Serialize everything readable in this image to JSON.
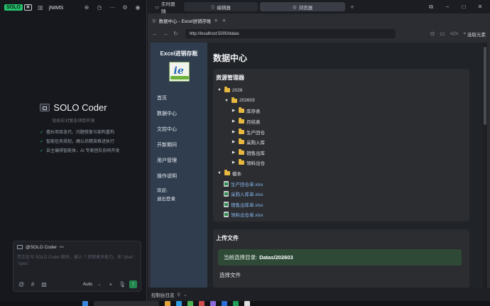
{
  "left": {
    "badge": "SOLO",
    "project_name": "jNIMS",
    "hero_title": "SOLO Coder",
    "hero_subtitle": "轻松应对复杂项目开发",
    "features": [
      "擅长项目迭代、问题修复与架构重构",
      "智能任务规划，确认后精准推进执行",
      "自主编排智能体，AI 专家团队协同开发"
    ],
    "composer": {
      "agent": "@SOLO Coder",
      "placeholder": "您正在与 SOLO Coder 聊天，输入 '/' 获取更多能力，如 '/plan', '/spec'",
      "mode": "Auto"
    }
  },
  "titlebar": {
    "tabs": [
      {
        "label": "实时跟随",
        "icon": "monitor-icon"
      },
      {
        "label": "编辑器",
        "icon": "code-icon"
      },
      {
        "label": "浏览器",
        "icon": "globe-icon"
      }
    ]
  },
  "browser": {
    "tab_title": "数据中心 - Excel进销存账",
    "url": "http://localhost:5000/datas",
    "pick_element": "选取元素",
    "console_label": "控制台日志"
  },
  "sidebar": {
    "title": "Excel进销存账",
    "items": [
      "首页",
      "数据中心",
      "文控中心",
      "开新期间",
      "用户管理",
      "操作说明"
    ],
    "welcome": "欢迎,",
    "logout": "退出登录"
  },
  "main": {
    "page_title": "数据中心",
    "resource_manager": "资源管理器",
    "tree": [
      {
        "level": 0,
        "type": "folder",
        "label": "2026",
        "expanded": true
      },
      {
        "level": 1,
        "type": "folder",
        "label": "202603",
        "expanded": true
      },
      {
        "level": 2,
        "type": "folder",
        "label": "库存表",
        "expanded": false
      },
      {
        "level": 2,
        "type": "folder",
        "label": "月结表",
        "expanded": false
      },
      {
        "level": 2,
        "type": "folder",
        "label": "生产回仓",
        "expanded": false
      },
      {
        "level": 2,
        "type": "folder",
        "label": "采购入库",
        "expanded": false
      },
      {
        "level": 2,
        "type": "folder",
        "label": "销售出库",
        "expanded": false
      },
      {
        "level": 2,
        "type": "folder",
        "label": "领料出仓",
        "expanded": false
      },
      {
        "level": 0,
        "type": "folder",
        "label": "模本",
        "expanded": true
      },
      {
        "level": 1,
        "type": "file",
        "label": "生产回仓单.xlsx"
      },
      {
        "level": 1,
        "type": "file",
        "label": "采购入库单.xlsx"
      },
      {
        "level": 1,
        "type": "file",
        "label": "销售出库单.xlsx"
      },
      {
        "level": 1,
        "type": "file",
        "label": "领料出仓单.xlsx"
      }
    ],
    "upload": {
      "title": "上传文件",
      "current_dir_label": "当前选择目录:",
      "current_dir_value": "Datas/202603",
      "choose_file": "选择文件"
    }
  }
}
